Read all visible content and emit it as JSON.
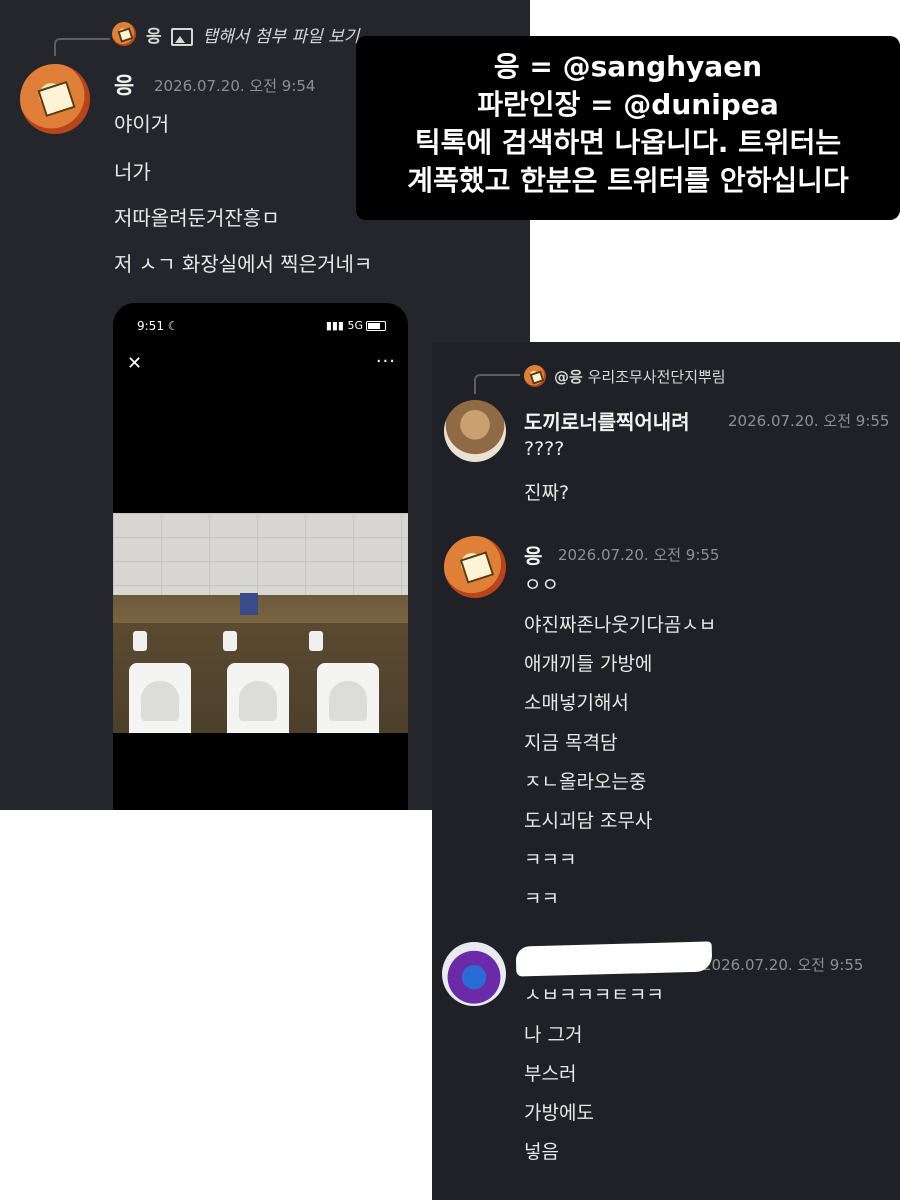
{
  "overlay": {
    "line1": "응 = @sanghyaen",
    "line2": "파란인장 = @dunipea",
    "line3": "틱톡에 검색하면 나옵니다. 트위터는",
    "line4": "계폭했고 한분은 트위터를 안하십니다"
  },
  "panel_a": {
    "reply": {
      "name": "응",
      "text": "탭해서 첨부 파일 보기"
    },
    "message": {
      "author": "응",
      "timestamp": "2026.07.20. 오전 9:54",
      "lines": [
        "야이거",
        "너가",
        "저따올려둔거잔흥ㅁ",
        "저 ㅅㄱ 화장실에서 찍은거네ㅋ"
      ]
    },
    "phone": {
      "time": "9:51",
      "network": "5G",
      "close_icon": "close-icon",
      "more_icon": "more-dots-icon"
    }
  },
  "panel_b": {
    "reply": {
      "name": "@응",
      "text": "우리조무사전단지뿌림"
    },
    "msg1": {
      "author": "도끼로너를찍어내려",
      "timestamp": "2026.07.20. 오전 9:55",
      "lines": [
        "????",
        "진짜?"
      ]
    },
    "msg2": {
      "author": "응",
      "timestamp": "2026.07.20. 오전 9:55",
      "lines": [
        "ㅇㅇ",
        "야진짜존나웃기다곰ㅅㅂ",
        "애개끼들 가방에",
        "소매넣기해서",
        "지금 목격담",
        "ㅈㄴ올라오는중",
        "도시괴담 조무사",
        "ㅋㅋㅋ",
        "ㅋㅋ"
      ]
    },
    "msg3": {
      "timestamp": "2026.07.20. 오전 9:55",
      "lines": [
        "ㅅㅂㅋㅋㅋㅌㅋㅋ",
        "나 그거",
        "부스러",
        "가방에도",
        "넣음"
      ]
    }
  }
}
